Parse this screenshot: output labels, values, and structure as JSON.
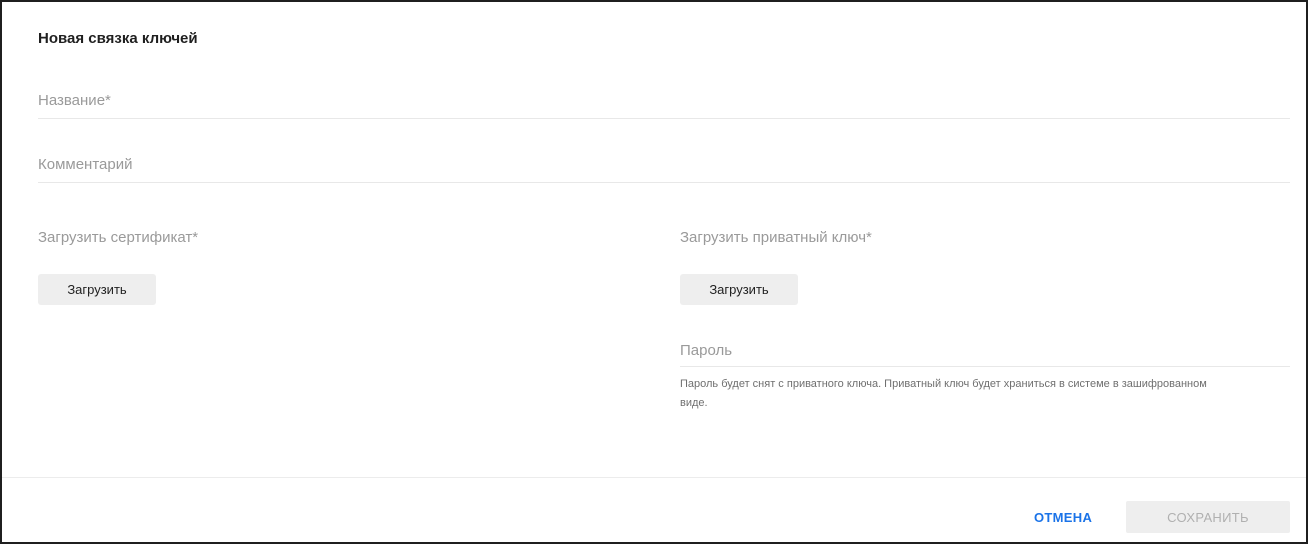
{
  "dialog": {
    "title": "Новая связка ключей"
  },
  "form": {
    "name_placeholder": "Название*",
    "name_value": "",
    "comment_placeholder": "Комментарий",
    "comment_value": "",
    "certificate_label": "Загрузить сертификат*",
    "certificate_upload_label": "Загрузить",
    "private_key_label": "Загрузить приватный ключ*",
    "private_key_upload_label": "Загрузить",
    "password_placeholder": "Пароль",
    "password_value": "",
    "password_hint": "Пароль будет снят с приватного ключа. Приватный ключ будет храниться в системе в зашифрованном виде."
  },
  "footer": {
    "cancel_label": "ОТМЕНА",
    "save_label": "СОХРАНИТЬ",
    "save_enabled": false
  },
  "colors": {
    "accent": "#1a73e8",
    "placeholder": "#9a9a9a",
    "button_bg": "#eeeeee",
    "disabled_text": "#b0b0b0"
  }
}
